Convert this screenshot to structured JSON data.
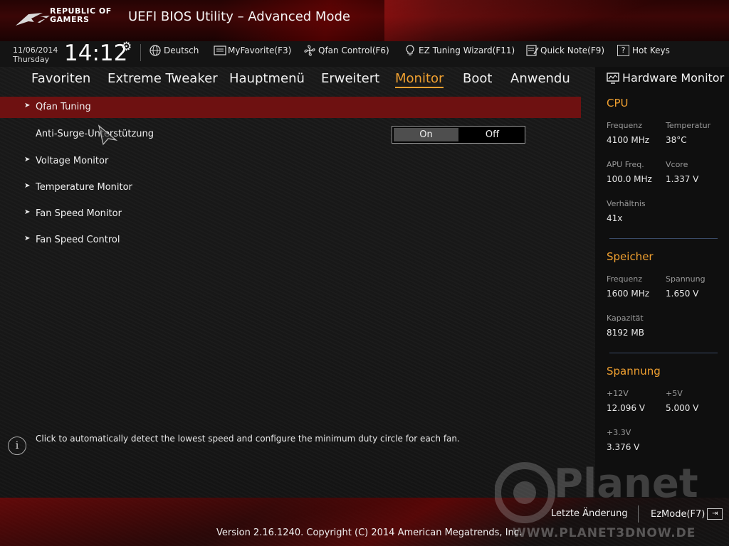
{
  "header": {
    "brand_line1": "REPUBLIC OF",
    "brand_line2": "GAMERS",
    "title": "UEFI BIOS Utility – Advanced Mode"
  },
  "toolbar": {
    "date": "11/06/2014",
    "day": "Thursday",
    "time": "14:12",
    "items": [
      {
        "label": "Deutsch",
        "icon": "globe-icon"
      },
      {
        "label": "MyFavorite(F3)",
        "icon": "favorite-icon"
      },
      {
        "label": "Qfan Control(F6)",
        "icon": "fan-icon"
      },
      {
        "label": "EZ Tuning Wizard(F11)",
        "icon": "lightbulb-icon"
      },
      {
        "label": "Quick Note(F9)",
        "icon": "note-icon"
      },
      {
        "label": "Hot Keys",
        "icon": "help-icon"
      }
    ]
  },
  "nav": {
    "tabs": [
      {
        "label": "Favoriten"
      },
      {
        "label": "Extreme Tweaker"
      },
      {
        "label": "Hauptmenü"
      },
      {
        "label": "Erweitert"
      },
      {
        "label": "Monitor",
        "active": true
      },
      {
        "label": "Boot"
      },
      {
        "label": "Anwendu"
      }
    ]
  },
  "main": {
    "items": [
      {
        "label": "Qfan Tuning",
        "arrow": true,
        "selected": true
      },
      {
        "label": "Anti-Surge-Unterstützung",
        "arrow": false
      },
      {
        "label": "Voltage Monitor",
        "arrow": true
      },
      {
        "label": "Temperature Monitor",
        "arrow": true
      },
      {
        "label": "Fan Speed Monitor",
        "arrow": true
      },
      {
        "label": "Fan Speed Control",
        "arrow": true
      }
    ],
    "toggle": {
      "on_label": "On",
      "off_label": "Off",
      "selected": "On"
    }
  },
  "monitor": {
    "title": "Hardware Monitor",
    "cpu": {
      "section": "CPU",
      "freq_label": "Frequenz",
      "freq_value": "4100 MHz",
      "temp_label": "Temperatur",
      "temp_value": "38°C",
      "apu_label": "APU Freq.",
      "apu_value": "100.0 MHz",
      "vcore_label": "Vcore",
      "vcore_value": "1.337 V",
      "ratio_label": "Verhältnis",
      "ratio_value": "41x"
    },
    "memory": {
      "section": "Speicher",
      "freq_label": "Frequenz",
      "freq_value": "1600 MHz",
      "volt_label": "Spannung",
      "volt_value": "1.650 V",
      "cap_label": "Kapazität",
      "cap_value": "8192 MB"
    },
    "voltage": {
      "section": "Spannung",
      "v12_label": "+12V",
      "v12_value": "12.096 V",
      "v5_label": "+5V",
      "v5_value": "5.000 V",
      "v33_label": "+3.3V",
      "v33_value": "3.376 V"
    }
  },
  "info": {
    "text": "Click to automatically detect the lowest speed and configure the minimum duty circle for each fan."
  },
  "footer": {
    "last_change": "Letzte Änderung",
    "ez_mode": "EzMode(F7)",
    "version": "Version 2.16.1240. Copyright (C) 2014 American Megatrends, Inc.",
    "watermark_main": "Planet",
    "watermark_url": "WWW.PLANET3DNOW.DE"
  },
  "colors": {
    "accent": "#f0a030",
    "selected_row": "#6e1111",
    "header_red": "#3a0606"
  }
}
